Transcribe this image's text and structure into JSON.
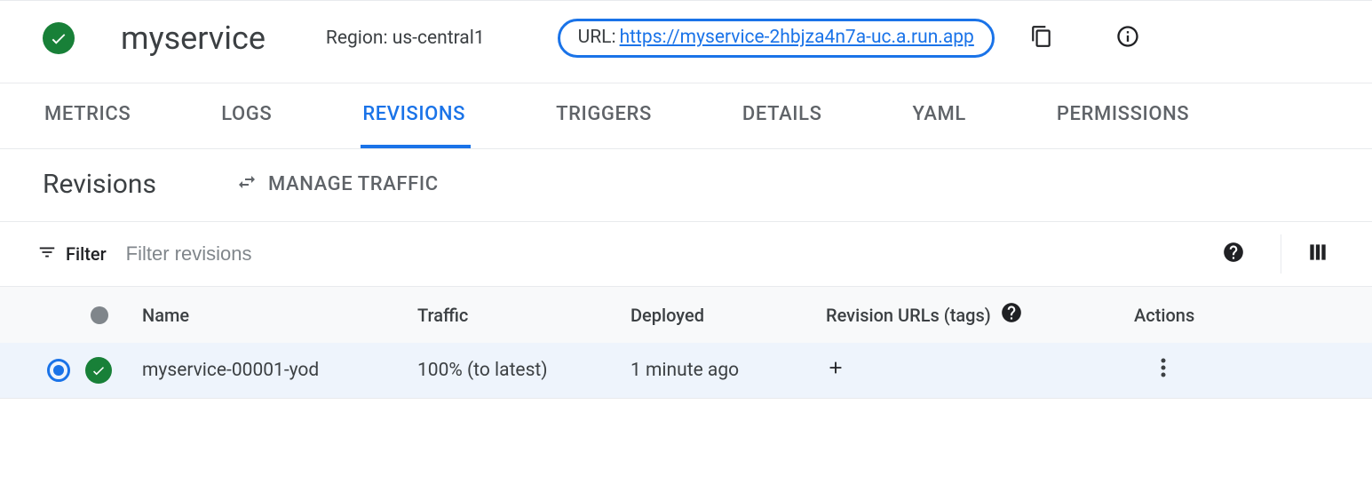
{
  "header": {
    "service_name": "myservice",
    "region_label": "Region: us-central1",
    "url_prefix": "URL:",
    "url": "https://myservice-2hbjza4n7a-uc.a.run.app"
  },
  "tabs": {
    "metrics": "METRICS",
    "logs": "LOGS",
    "revisions": "REVISIONS",
    "triggers": "TRIGGERS",
    "details": "DETAILS",
    "yaml": "YAML",
    "permissions": "PERMISSIONS"
  },
  "sub": {
    "title": "Revisions",
    "manage": "MANAGE TRAFFIC"
  },
  "filter": {
    "label": "Filter",
    "placeholder": "Filter revisions"
  },
  "columns": {
    "name": "Name",
    "traffic": "Traffic",
    "deployed": "Deployed",
    "tags": "Revision URLs (tags)",
    "actions": "Actions"
  },
  "rows": [
    {
      "name": "myservice-00001-yod",
      "traffic": "100% (to latest)",
      "deployed": "1 minute ago"
    }
  ]
}
